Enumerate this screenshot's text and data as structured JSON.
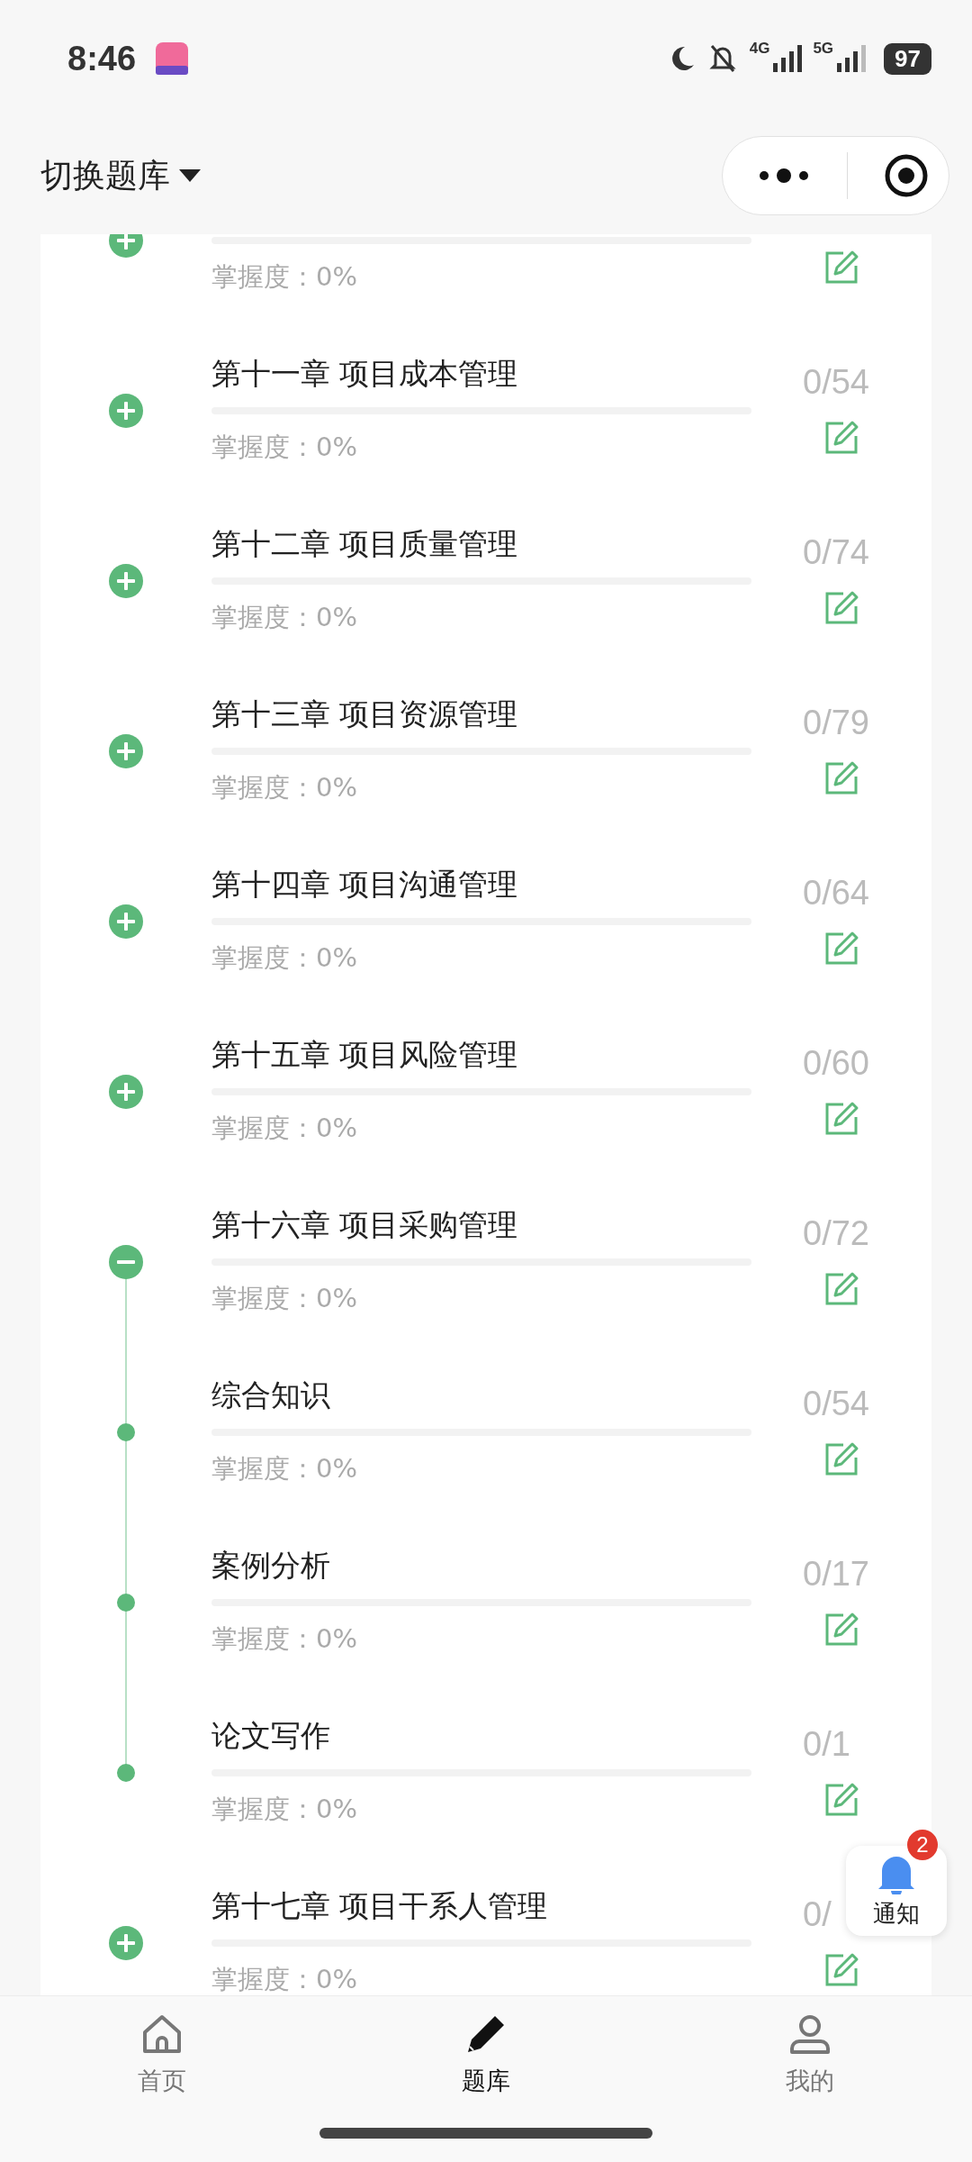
{
  "status_bar": {
    "time": "8:46",
    "network_1": "4G",
    "network_2": "5G",
    "battery": "97"
  },
  "header": {
    "title": "切换题库"
  },
  "chapters": [
    {
      "mastery": "掌握度：0%",
      "expanded": false
    },
    {
      "title": "第十一章 项目成本管理",
      "count": "0/54",
      "mastery": "掌握度：0%",
      "expanded": false
    },
    {
      "title": "第十二章 项目质量管理",
      "count": "0/74",
      "mastery": "掌握度：0%",
      "expanded": false
    },
    {
      "title": "第十三章 项目资源管理",
      "count": "0/79",
      "mastery": "掌握度：0%",
      "expanded": false
    },
    {
      "title": "第十四章 项目沟通管理",
      "count": "0/64",
      "mastery": "掌握度：0%",
      "expanded": false
    },
    {
      "title": "第十五章 项目风险管理",
      "count": "0/60",
      "mastery": "掌握度：0%",
      "expanded": false
    },
    {
      "title": "第十六章 项目采购管理",
      "count": "0/72",
      "mastery": "掌握度：0%",
      "expanded": true,
      "children": [
        {
          "title": "综合知识",
          "count": "0/54",
          "mastery": "掌握度：0%"
        },
        {
          "title": "案例分析",
          "count": "0/17",
          "mastery": "掌握度：0%"
        },
        {
          "title": "论文写作",
          "count": "0/1",
          "mastery": "掌握度：0%"
        }
      ]
    },
    {
      "title": "第十七章 项目干系人管理",
      "count": "0/",
      "mastery": "掌握度：0%",
      "expanded": false
    }
  ],
  "notification": {
    "label": "通知",
    "badge": "2"
  },
  "tabs": [
    {
      "label": "首页",
      "selected": false
    },
    {
      "label": "题库",
      "selected": true
    },
    {
      "label": "我的",
      "selected": false
    }
  ]
}
